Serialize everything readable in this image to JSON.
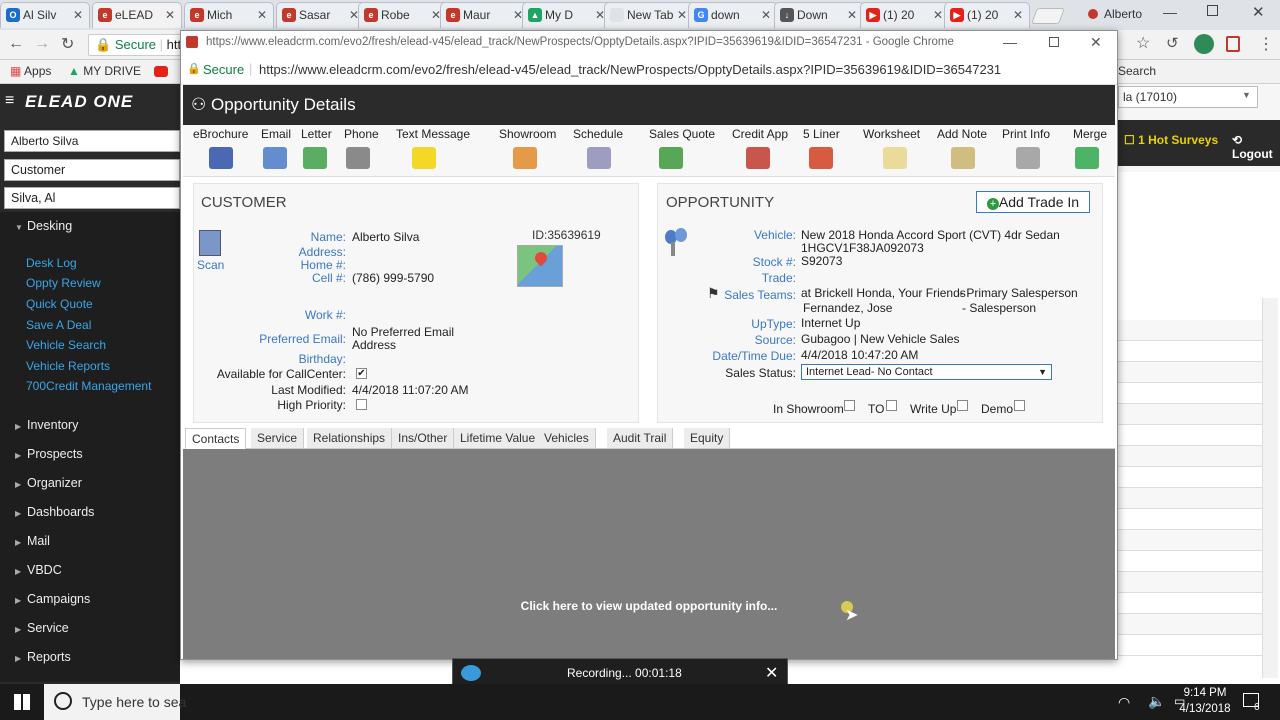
{
  "chrome": {
    "tabs": [
      {
        "label": "Al Silv",
        "color": "#1e6cc8",
        "glyph": "O"
      },
      {
        "label": "eLEAD",
        "color": "#c0392b",
        "glyph": "e"
      },
      {
        "label": "Mich",
        "color": "#c0392b",
        "glyph": "e"
      },
      {
        "label": "Sasar",
        "color": "#c0392b",
        "glyph": "e"
      },
      {
        "label": "Robe",
        "color": "#c0392b",
        "glyph": "e"
      },
      {
        "label": "Maur",
        "color": "#c0392b",
        "glyph": "e"
      },
      {
        "label": "My D",
        "color": "#1fa463",
        "glyph": "▲"
      },
      {
        "label": "New Tab",
        "color": "#dfe3e8",
        "glyph": ""
      },
      {
        "label": "down",
        "color": "#4285f4",
        "glyph": "G"
      },
      {
        "label": "Down",
        "color": "#555555",
        "glyph": "↓"
      },
      {
        "label": "(1) 20",
        "color": "#e62117",
        "glyph": "▶"
      },
      {
        "label": "(1) 20",
        "color": "#e62117",
        "glyph": "▶"
      }
    ],
    "user_name": "Alberto",
    "secure_label": "Secure",
    "url_fragment": "htt",
    "bookmarks": {
      "apps": "Apps",
      "drive": "MY DRIVE"
    }
  },
  "popup": {
    "title_bar": "https://www.eleadcrm.com/evo2/fresh/elead-v45/elead_track/NewProspects/OpptyDetails.aspx?IPID=35639619&IDID=36547231 - Google Chrome",
    "secure_label": "Secure",
    "url": "https://www.eleadcrm.com/evo2/fresh/elead-v45/elead_track/NewProspects/OpptyDetails.aspx?IPID=35639619&IDID=36547231",
    "page_title": "Opportunity Details",
    "actions": [
      "eBrochure",
      "Email",
      "Letter",
      "Phone",
      "Text Message",
      "Showroom",
      "Schedule",
      "Sales Quote",
      "Credit App",
      "5 Liner",
      "Worksheet",
      "Add Note",
      "Print Info",
      "Merge"
    ]
  },
  "customer": {
    "heading": "CUSTOMER",
    "scan_label": "Scan",
    "id_label": "ID:35639619",
    "name_label": "Name:",
    "name": "Alberto Silva",
    "address_label": "Address:",
    "home_label": "Home #:",
    "cell_label": "Cell #:",
    "cell": "(786) 999-5790",
    "work_label": "Work #:",
    "pref_email_label": "Preferred Email:",
    "pref_email_1": "No Preferred Email",
    "pref_email_2": "Address",
    "birthday_label": "Birthday:",
    "callcenter_label": "Available for CallCenter:",
    "last_modified_label": "Last Modified:",
    "last_modified": "4/4/2018 11:07:20 AM",
    "high_priority_label": "High Priority:"
  },
  "opportunity": {
    "heading": "OPPORTUNITY",
    "add_trade_button": "Add Trade In",
    "vehicle_label": "Vehicle:",
    "vehicle_1": "New 2018 Honda Accord Sport (CVT) 4dr Sedan",
    "vehicle_2": "1HGCV1F38JA092073",
    "stock_label": "Stock #:",
    "stock": "S92073",
    "trade_label": "Trade:",
    "sales_teams_label": "Sales Teams:",
    "team_1": "at Brickell Honda, Your Friends",
    "role_1": "- Primary Salesperson",
    "team_2": "Fernandez, Jose",
    "role_2": "- Salesperson",
    "uptype_label": "UpType:",
    "uptype": "Internet Up",
    "source_label": "Source:",
    "source": "Gubagoo | New Vehicle Sales",
    "date_label": "Date/Time Due:",
    "date": "4/4/2018 10:47:20 AM",
    "sales_status_label": "Sales Status:",
    "sales_status": "Internet Lead- No Contact",
    "in_showroom": "In Showroom",
    "to": "TO",
    "write_up": "Write Up",
    "demo": "Demo"
  },
  "detail_tabs": [
    "Contacts",
    "Service",
    "Relationships",
    "Ins/Other",
    "Lifetime Value",
    "Vehicles",
    "Audit Trail",
    "Equity"
  ],
  "gray_message": "Click here to view updated opportunity info...",
  "leftnav": {
    "brand": "ELEAD ONE",
    "field_name": "Alberto Silva",
    "field_type": "Customer",
    "field_search": "Silva, Al",
    "desking": "Desking",
    "desking_links": [
      "Desk Log",
      "Oppty Review",
      "Quick Quote",
      "Save A Deal",
      "Vehicle Search",
      "Vehicle Reports",
      "700Credit Management"
    ],
    "sections": [
      "Inventory",
      "Prospects",
      "Organizer",
      "Dashboards",
      "Mail",
      "VBDC",
      "Campaigns",
      "Service",
      "Reports"
    ]
  },
  "right": {
    "search_label": "Search",
    "dealer": "la (17010)",
    "hot_surveys": "1 Hot Surveys",
    "logout": "Logout"
  },
  "recorder": {
    "status": "Recording... 00:01:18"
  },
  "taskbar": {
    "search_placeholder": "Type here to sea",
    "time": "9:14 PM",
    "date": "4/13/2018",
    "notif_count": "6"
  }
}
